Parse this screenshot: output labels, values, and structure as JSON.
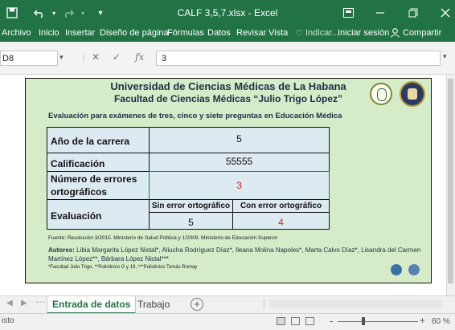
{
  "window": {
    "title": "CALF 3,5,7.xlsx - Excel"
  },
  "ribbon": {
    "tabs": [
      "Archivo",
      "Inicio",
      "Insertar",
      "Diseño de página",
      "Fórmulas",
      "Datos",
      "Revisar",
      "Vista"
    ],
    "tell_me": "Indicar...",
    "signin": "Iniciar sesión",
    "share": "Compartir"
  },
  "formula_bar": {
    "name_box": "D8",
    "fx": "fx",
    "value": "3"
  },
  "form": {
    "university": "Universidad de Ciencias Médicas de La Habana",
    "faculty": "Facultad de Ciencias Médicas “Julio Trigo López”",
    "eval_title": "Evaluación para exámenes de tres, cinco y siete preguntas en Educación Médica",
    "rows": {
      "year_label": "Año de la carrera",
      "year_value": "5",
      "grade_label": "Calificación",
      "grade_value": "55555",
      "errors_label": "Número de errores ortográficos",
      "errors_value": "3",
      "eval_label": "Evaluación",
      "without_error_label": "Sin error ortográfico",
      "with_error_label": "Con error ortográfico",
      "without_error_value": "5",
      "with_error_value": "4"
    },
    "source": "Fuente: Resolución 3/2015. Ministerio de Salud Pública y 1/2009. Ministerio de Educación Superior",
    "authors_label": "Autores:",
    "authors": "Libia Margarita López Nistal*, Aliucha Rodríguez Díaz*, Ileana Molina Napoles*, Marta Calvo Díaz*, Lisandra del Carmen Martínez López**, Bárbara López Nistal***",
    "footnote": "*Facultad Julio Trigo, **Policlinico G y 19, ***Policlinico Tomás Romay"
  },
  "sheets": {
    "active": "Entrada de datos",
    "other": "Trabajo",
    "add": "+"
  },
  "status": {
    "mode": "isto",
    "zoom": "60 %",
    "zoom_minus": "-",
    "zoom_plus": "+"
  },
  "colors": {
    "excel_green": "#217346",
    "form_bg": "#d6ebc7",
    "cell_bg": "#ddeaf2",
    "red_value": "#e01b1b"
  }
}
